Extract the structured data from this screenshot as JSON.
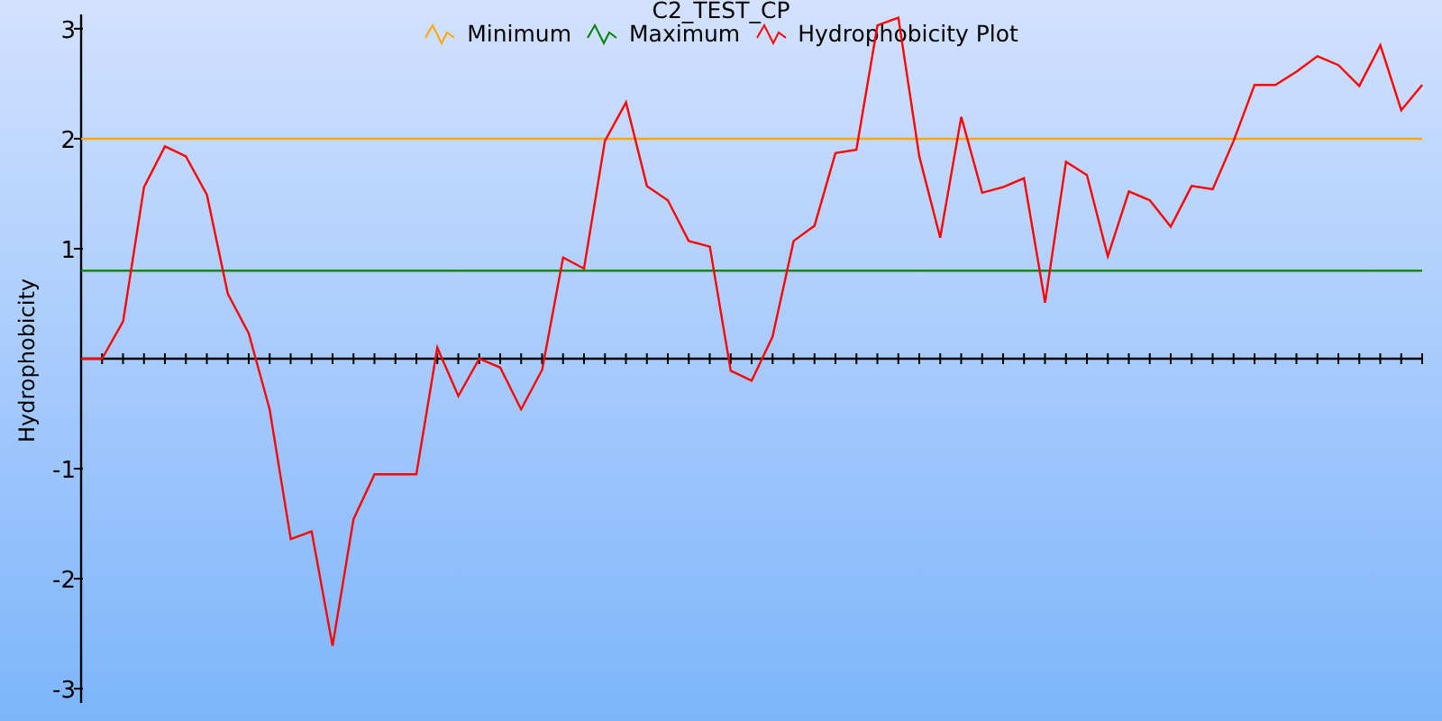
{
  "chart": {
    "chart_data": {
      "type": "line",
      "title": "C2_TEST_CP",
      "ylabel": "Hydrophobicity",
      "ylim": [
        -3.13,
        3.13
      ],
      "yticks": [
        -3,
        -2,
        -1,
        1,
        2,
        3
      ],
      "series": [
        {
          "name": "Minimum",
          "color": "#ffa500",
          "values": [
            2,
            2,
            2,
            2,
            2,
            2,
            2,
            2,
            2,
            2,
            2,
            2,
            2,
            2,
            2,
            2,
            2,
            2,
            2,
            2,
            2,
            2,
            2,
            2,
            2,
            2,
            2,
            2,
            2,
            2,
            2,
            2,
            2,
            2,
            2,
            2,
            2,
            2,
            2,
            2,
            2,
            2,
            2,
            2,
            2,
            2,
            2,
            2,
            2,
            2,
            2,
            2,
            2,
            2,
            2,
            2,
            2,
            2,
            2,
            2,
            2,
            2,
            2,
            2,
            2
          ]
        },
        {
          "name": "Maximum",
          "color": "#008000",
          "values": [
            0.8,
            0.8,
            0.8,
            0.8,
            0.8,
            0.8,
            0.8,
            0.8,
            0.8,
            0.8,
            0.8,
            0.8,
            0.8,
            0.8,
            0.8,
            0.8,
            0.8,
            0.8,
            0.8,
            0.8,
            0.8,
            0.8,
            0.8,
            0.8,
            0.8,
            0.8,
            0.8,
            0.8,
            0.8,
            0.8,
            0.8,
            0.8,
            0.8,
            0.8,
            0.8,
            0.8,
            0.8,
            0.8,
            0.8,
            0.8,
            0.8,
            0.8,
            0.8,
            0.8,
            0.8,
            0.8,
            0.8,
            0.8,
            0.8,
            0.8,
            0.8,
            0.8,
            0.8,
            0.8,
            0.8,
            0.8,
            0.8,
            0.8,
            0.8,
            0.8,
            0.8,
            0.8,
            0.8,
            0.8,
            0.8
          ]
        },
        {
          "name": "Hydrophobicity Plot",
          "color": "#ff0000",
          "values": [
            0,
            0,
            0.34,
            1.56,
            1.93,
            1.84,
            1.49,
            0.59,
            0.23,
            -0.46,
            -1.64,
            -1.57,
            -2.61,
            -1.46,
            -1.05,
            -1.05,
            -1.05,
            0.1,
            -0.34,
            0,
            -0.08,
            -0.46,
            -0.1,
            0.92,
            0.82,
            1.98,
            2.33,
            1.57,
            1.44,
            1.07,
            1.02,
            -0.11,
            -0.2,
            0.2,
            1.07,
            1.21,
            1.87,
            1.9,
            3.03,
            3.1,
            1.84,
            1.1,
            2.2,
            1.51,
            1.56,
            1.64,
            0.51,
            1.79,
            1.67,
            0.93,
            1.52,
            1.44,
            1.2,
            1.57,
            1.54,
            1.98,
            2.49,
            2.49,
            2.61,
            2.75,
            2.67,
            2.48,
            2.85,
            2.26,
            2.49
          ]
        }
      ]
    }
  }
}
